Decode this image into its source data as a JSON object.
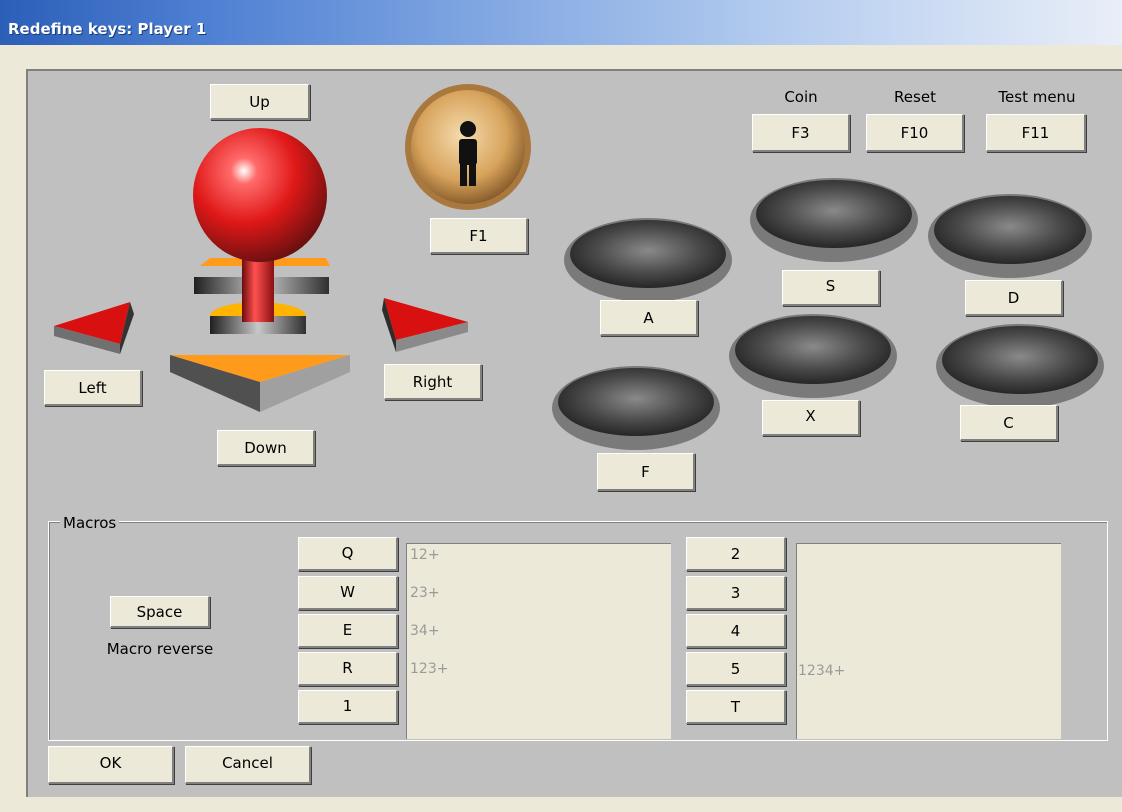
{
  "window": {
    "title": "Redefine keys: Player 1"
  },
  "joystick": {
    "up": "Up",
    "down": "Down",
    "left": "Left",
    "right": "Right"
  },
  "start": {
    "key": "F1"
  },
  "system": {
    "coin_label": "Coin",
    "coin_key": "F3",
    "reset_label": "Reset",
    "reset_key": "F10",
    "test_label": "Test menu",
    "test_key": "F11"
  },
  "buttons": {
    "a": "A",
    "s": "S",
    "d": "D",
    "x": "X",
    "c": "C",
    "f": "F"
  },
  "macros": {
    "title": "Macros",
    "reverse_key": "Space",
    "reverse_label": "Macro reverse",
    "left_keys": [
      "Q",
      "W",
      "E",
      "R",
      "1"
    ],
    "left_values": [
      "12+",
      "23+",
      "34+",
      "123+"
    ],
    "right_keys": [
      "2",
      "3",
      "4",
      "5",
      "T"
    ],
    "right_value": "1234+"
  },
  "footer": {
    "ok": "OK",
    "cancel": "Cancel"
  },
  "colors": {
    "ball": "#e01818",
    "arrow": "#d81010",
    "base": "#ff9a1a",
    "panel": "#c0c0c0"
  },
  "icons": {
    "start": "player-start-icon"
  }
}
